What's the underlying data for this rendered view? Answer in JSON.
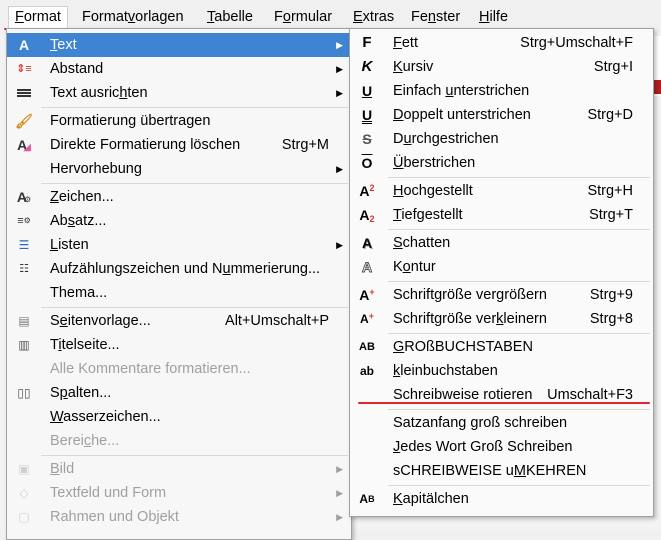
{
  "menubar": {
    "items": [
      {
        "label": "Format",
        "u": "F",
        "rest": "ormat"
      },
      {
        "label": "Formatvorlagen",
        "pre": "Format",
        "u": "v",
        "rest": "orlagen"
      },
      {
        "label": "Tabelle",
        "u": "T",
        "rest": "abelle"
      },
      {
        "label": "Formular",
        "pre": "F",
        "u": "o",
        "rest": "rmular"
      },
      {
        "label": "Extras",
        "u": "E",
        "rest": "xtras"
      },
      {
        "label": "Fenster",
        "pre": "Fe",
        "u": "n",
        "rest": "ster"
      },
      {
        "label": "Hilfe",
        "u": "H",
        "rest": "ilfe"
      }
    ]
  },
  "format_menu": {
    "text": {
      "label": "Text",
      "u": "T",
      "rest": "ext"
    },
    "abstand": {
      "label": "Abstand"
    },
    "ausrichten": {
      "label": "Text ausrichten",
      "pre": "Text ausric",
      "u": "h",
      "rest": "ten"
    },
    "uebertragen": {
      "label": "Formatierung übertragen"
    },
    "loeschen": {
      "label": "Direkte Formatierung löschen",
      "shortcut": "Strg+M"
    },
    "hervorhebung": {
      "label": "Hervorhebung"
    },
    "zeichen": {
      "label": "Zeichen...",
      "u": "Z",
      "rest": "eichen..."
    },
    "absatz": {
      "label": "Absatz...",
      "pre": "Ab",
      "u": "s",
      "rest": "atz..."
    },
    "listen": {
      "label": "Listen",
      "u": "L",
      "rest": "isten"
    },
    "aufzaehlung": {
      "label": "Aufzählungszeichen und Nummerierung...",
      "pre": "Aufzählungszeichen und N",
      "u": "u",
      "rest": "mmerierung..."
    },
    "thema": {
      "label": "Thema..."
    },
    "seitenvorlage": {
      "label": "Seitenvorlage...",
      "pre": "S",
      "u": "e",
      "rest": "itenvorlage...",
      "shortcut": "Alt+Umschalt+P"
    },
    "titelseite": {
      "label": "Titelseite...",
      "pre": "T",
      "u": "i",
      "rest": "telseite..."
    },
    "kommentare": {
      "label": "Alle Kommentare formatieren..."
    },
    "spalten": {
      "label": "Spalten...",
      "pre": "S",
      "u": "p",
      "rest": "alten..."
    },
    "wasserzeichen": {
      "label": "Wasserzeichen...",
      "u": "W",
      "rest": "asserzeichen..."
    },
    "bereiche": {
      "label": "Bereiche...",
      "pre": "Berei",
      "u": "c",
      "rest": "he..."
    },
    "bild": {
      "label": "Bild",
      "u": "B",
      "rest": "ild"
    },
    "textfeld": {
      "label": "Textfeld und Form"
    },
    "rahmen": {
      "label": "Rahmen und Objekt"
    }
  },
  "text_submenu": {
    "fett": {
      "label": "Fett",
      "u": "F",
      "rest": "ett",
      "shortcut": "Strg+Umschalt+F"
    },
    "kursiv": {
      "label": "Kursiv",
      "u": "K",
      "rest": "ursiv",
      "shortcut": "Strg+I"
    },
    "einfach": {
      "label": "Einfach unterstrichen",
      "pre": "Einfach ",
      "u": "u",
      "rest": "nterstrichen"
    },
    "doppelt": {
      "label": "Doppelt unterstrichen",
      "u": "D",
      "rest": "oppelt unterstrichen",
      "shortcut": "Strg+D"
    },
    "durch": {
      "label": "Durchgestrichen",
      "pre": "D",
      "u": "u",
      "rest": "rchgestrichen"
    },
    "ueber": {
      "label": "Überstrichen",
      "u": "Ü",
      "rest": "berstrichen"
    },
    "hoch": {
      "label": "Hochgestellt",
      "u": "H",
      "rest": "ochgestellt",
      "shortcut": "Strg+H"
    },
    "tief": {
      "label": "Tiefgestellt",
      "u": "T",
      "rest": "iefgestellt",
      "shortcut": "Strg+T"
    },
    "schatten": {
      "label": "Schatten",
      "u": "S",
      "rest": "chatten"
    },
    "kontur": {
      "label": "Kontur",
      "pre": "K",
      "u": "o",
      "rest": "ntur"
    },
    "groesser": {
      "label": "Schriftgröße vergrößern",
      "pre": "Schriftgröße ver",
      "u": "g",
      "rest": "rößern",
      "shortcut": "Strg+9"
    },
    "kleiner": {
      "label": "Schriftgröße verkleinern",
      "pre": "Schriftgröße ver",
      "u": "k",
      "rest": "leinern",
      "shortcut": "Strg+8"
    },
    "gross": {
      "label": "GROßBUCHSTABEN",
      "u": "G",
      "rest": "ROßBUCHSTABEN"
    },
    "klein": {
      "label": "kleinbuchstaben",
      "u": "k",
      "rest": "leinbuchstaben"
    },
    "rotieren": {
      "label": "Schreibweise rotieren",
      "shortcut": "Umschalt+F3"
    },
    "satzanfang": {
      "label": "Satzanfang groß schreiben"
    },
    "jedes": {
      "label": "Jedes Wort Groß Schreiben",
      "u": "J",
      "rest": "edes Wort Groß Schreiben"
    },
    "umkehren": {
      "label": "sCHREIBWEISE uMKEHREN",
      "pre": "sCHREIBWEISE u",
      "u": "M",
      "rest": "KEHREN"
    },
    "kapitaelchen": {
      "label": "Kapitälchen",
      "u": "K",
      "rest": "apitälchen"
    }
  },
  "colors": {
    "highlight": "#3e84d3",
    "annotation": "#e0262d",
    "disabled": "#a0a0a0"
  }
}
